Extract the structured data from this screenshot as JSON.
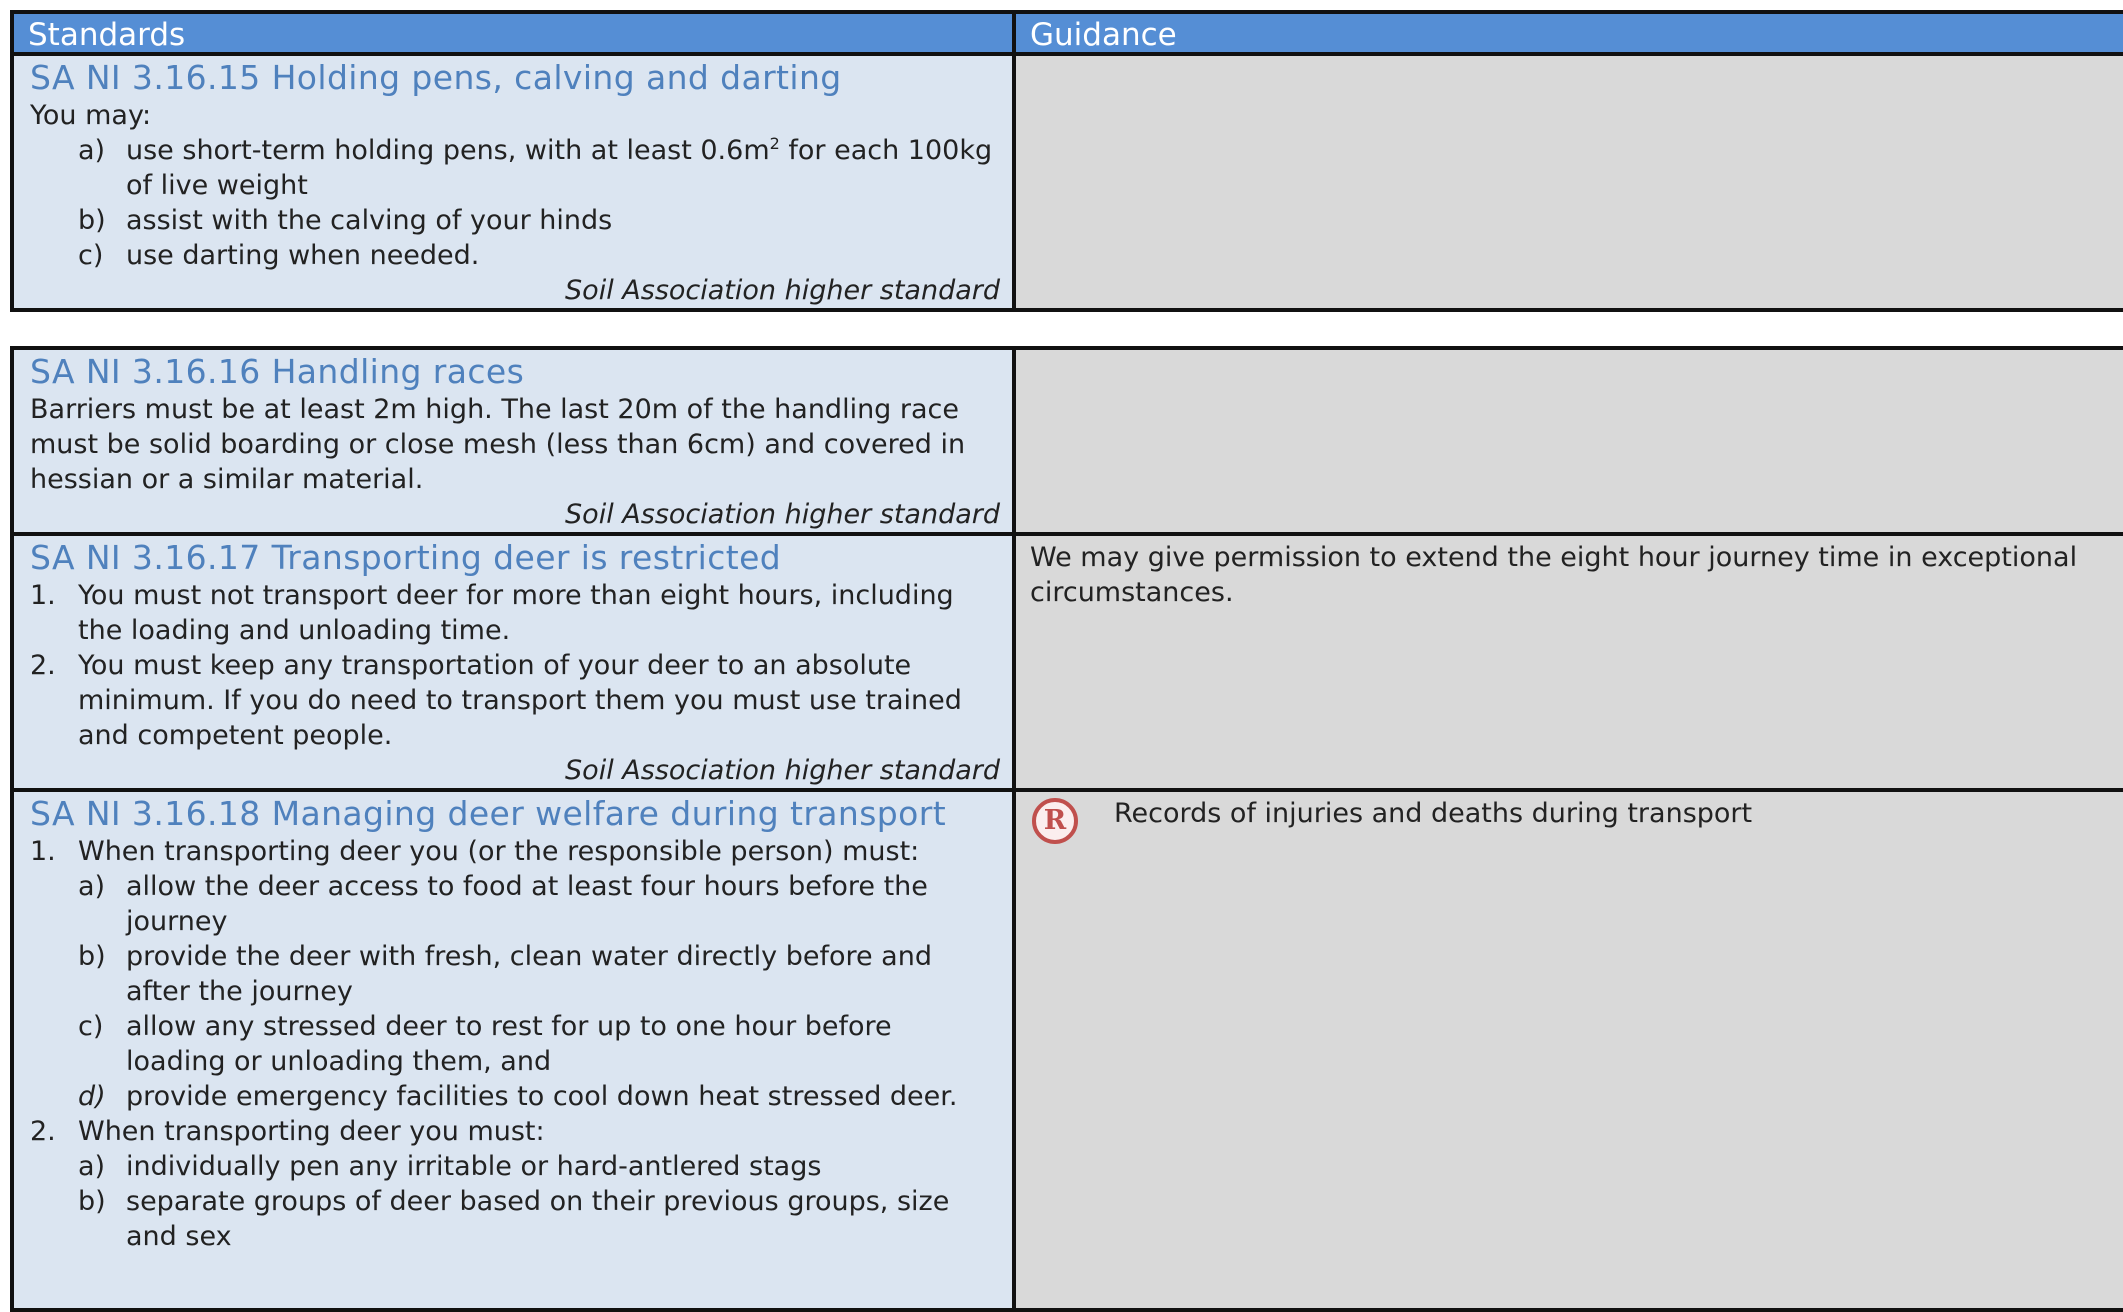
{
  "header": {
    "standards": "Standards",
    "guidance": "Guidance"
  },
  "s15": {
    "title": "SA NI 3.16.15 Holding pens, calving and darting",
    "intro": "You may:",
    "a_marker": "a)",
    "a_text_1": "use short-term holding pens, with at least 0.6m",
    "a_sup": "2",
    "a_text_2": " for each 100kg of live weight",
    "b_marker": "b)",
    "b_text": "assist with the calving of your hinds",
    "c_marker": "c)",
    "c_text": "use darting when needed.",
    "tag": "Soil Association higher standard"
  },
  "s16": {
    "title": "SA NI 3.16.16 Handling races",
    "text": "Barriers must be at least 2m high. The last 20m of the handling race must be solid boarding or close mesh (less than 6cm) and covered in hessian or a similar material.",
    "tag": "Soil Association higher standard"
  },
  "s17": {
    "title": "SA NI 3.16.17 Transporting deer is restricted",
    "i1_marker": "1.",
    "i1_text": "You must not transport deer for more than eight hours, including the loading and unloading time.",
    "i2_marker": "2.",
    "i2_text": "You must keep any transportation of your deer to an absolute minimum. If you do need to transport them you must use trained and competent people.",
    "tag": "Soil Association higher standard",
    "guidance": "We may give permission to extend the eight hour journey time in exceptional circumstances."
  },
  "s18": {
    "title": "SA NI 3.16.18 Managing deer welfare during transport",
    "i1_marker": "1.",
    "i1_text": "When transporting deer you (or the responsible person) must:",
    "i1a_marker": "a)",
    "i1a_text": "allow the deer access to food at least four hours before the journey",
    "i1b_marker": "b)",
    "i1b_text": "provide the deer with fresh, clean water directly before and after the journey",
    "i1c_marker": "c)",
    "i1c_text": "allow any stressed deer to rest for up to one hour before loading or unloading them, and",
    "i1d_marker": "d)",
    "i1d_text": "provide emergency facilities to cool down heat stressed deer.",
    "i2_marker": "2.",
    "i2_text": "When transporting deer you must:",
    "i2a_marker": "a)",
    "i2a_text": "individually pen any irritable or hard-antlered stags",
    "i2b_marker": "b)",
    "i2b_text": "separate groups of deer based on their previous groups, size and sex",
    "record_icon_letter": "R",
    "record_icon": "record-required-icon",
    "record_text": "Records of injuries and deaths during transport"
  }
}
